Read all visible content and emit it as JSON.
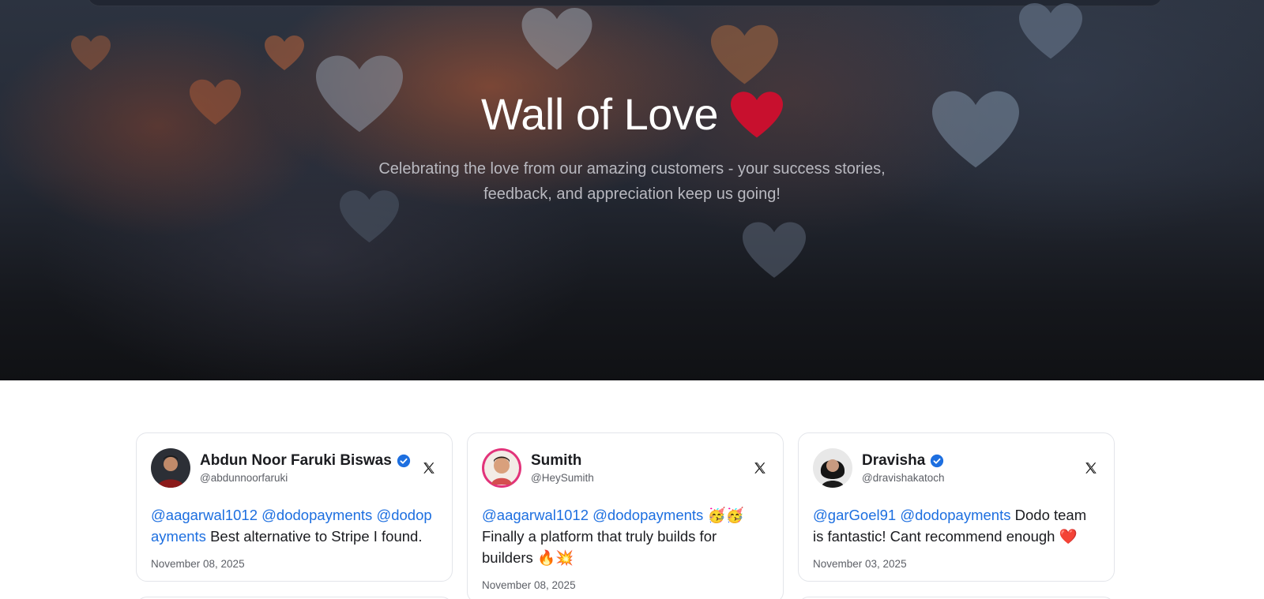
{
  "hero": {
    "title": "Wall of Love",
    "title_icon": "heart-icon",
    "subtitle_line1": "Celebrating the love from our amazing customers - your success stories,",
    "subtitle_line2": "feedback, and appreciation keep us going!",
    "heart_color": "#c8102e"
  },
  "colors": {
    "mention": "#1d6fe0",
    "verified": "#1d6fe0",
    "text": "#1b1c20",
    "muted": "#5c5f66"
  },
  "testimonials": [
    {
      "name": "Abdun Noor Faruki Biswas",
      "verified": true,
      "handle": "@abdunnoorfaruki",
      "platform_icon": "x-logo-icon",
      "mentions": [
        "@aagarwal1012",
        "@dodopayments",
        "@dodopayments"
      ],
      "text": "Best alternative to Stripe I found.",
      "date": "November 08, 2025"
    },
    {
      "name": "Sumith",
      "verified": false,
      "handle": "@HeySumith",
      "platform_icon": "x-logo-icon",
      "mentions": [
        "@aagarwal1012",
        "@dodopayments"
      ],
      "emoji_after_mentions": "🥳🥳",
      "text": "Finally a platform that truly builds for builders",
      "emoji_end": "🔥💥",
      "date": "November 08, 2025"
    },
    {
      "name": "Dravisha",
      "verified": true,
      "handle": "@dravishakatoch",
      "platform_icon": "x-logo-icon",
      "mentions": [
        "@garGoel91",
        "@dodopayments"
      ],
      "text": "Dodo team is fantastic! Cant recommend enough",
      "emoji_end": "❤️",
      "date": "November 03, 2025"
    }
  ]
}
